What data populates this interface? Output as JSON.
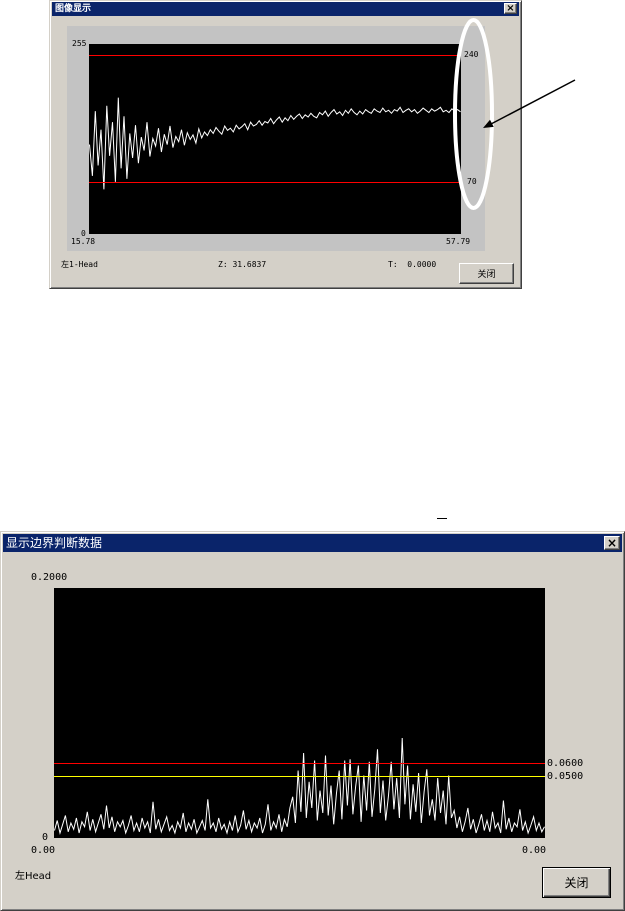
{
  "colors": {
    "title_bar": "#0a246a",
    "dialog_face": "#d4d0c8",
    "plot_panel": "#c3c3c3",
    "annotation_ellipse": "#ffffff",
    "annotation_arrow": "#000000"
  },
  "icons": {
    "close": "close-icon",
    "close_glyph": "×"
  },
  "top_window": {
    "title": "图像显示",
    "status": {
      "channel": "左1-Head",
      "z": "Z: 31.6837",
      "t": "T:  0.0000"
    },
    "close_button_label": "关闭"
  },
  "bottom_window": {
    "title": "显示边界判断数据",
    "channel_label": "左Head",
    "close_button_label": "关闭"
  },
  "chart_data": [
    {
      "type": "line",
      "xlim": [
        15.78,
        57.79
      ],
      "ylim": [
        0,
        255
      ],
      "x_tick_labels": [
        "15.78",
        "57.79"
      ],
      "y_tick_labels": [
        "0",
        "255"
      ],
      "grid": false,
      "plot_background": "#000000",
      "thresholds": [
        {
          "value": 240,
          "label": "240",
          "color": "#ff0000"
        },
        {
          "value": 70,
          "label": "70",
          "color": "#ff0000"
        }
      ],
      "series": [
        {
          "color": "#ffffff",
          "values": [
            120,
            78,
            165,
            92,
            140,
            60,
            172,
            105,
            150,
            70,
            183,
            88,
            158,
            74,
            135,
            102,
            146,
            95,
            130,
            112,
            150,
            104,
            128,
            118,
            142,
            110,
            134,
            120,
            145,
            116,
            131,
            124,
            140,
            119,
            136,
            127,
            133,
            122,
            141,
            129,
            137,
            132,
            140,
            135,
            143,
            138,
            134,
            145,
            139,
            142,
            137,
            146,
            141,
            144,
            148,
            140,
            150,
            145,
            147,
            152,
            146,
            151,
            149,
            155,
            148,
            153,
            157,
            150,
            156,
            152,
            159,
            154,
            158,
            161,
            155,
            160,
            157,
            162,
            158,
            156,
            163,
            160,
            165,
            158,
            163,
            167,
            161,
            164,
            159,
            166,
            162,
            168,
            163,
            160,
            165,
            161,
            167,
            164,
            162,
            168,
            165,
            163,
            169,
            164,
            166,
            162,
            167,
            165,
            170,
            163,
            166,
            168,
            164,
            167,
            162,
            165,
            169,
            166,
            163,
            168,
            165,
            167,
            170,
            164,
            166,
            163,
            168,
            165,
            167,
            164
          ]
        }
      ]
    },
    {
      "type": "line",
      "ylim": [
        0,
        0.2
      ],
      "x_tick_labels": [
        "0.00",
        "0.00"
      ],
      "y_tick_labels": [
        "0",
        "0.2000"
      ],
      "grid": false,
      "plot_background": "#000000",
      "thresholds": [
        {
          "value": 0.06,
          "label": "0.0600",
          "color": "#ff0000"
        },
        {
          "value": 0.05,
          "label": "0.0500",
          "color": "#ffff00"
        }
      ],
      "series": [
        {
          "color": "#ffffff",
          "values": [
            0.006,
            0.014,
            0.004,
            0.011,
            0.018,
            0.005,
            0.012,
            0.007,
            0.016,
            0.004,
            0.013,
            0.009,
            0.021,
            0.006,
            0.015,
            0.005,
            0.012,
            0.019,
            0.007,
            0.026,
            0.008,
            0.017,
            0.005,
            0.013,
            0.009,
            0.014,
            0.004,
            0.01,
            0.018,
            0.006,
            0.012,
            0.005,
            0.016,
            0.008,
            0.013,
            0.004,
            0.029,
            0.007,
            0.015,
            0.005,
            0.011,
            0.017,
            0.006,
            0.01,
            0.004,
            0.013,
            0.008,
            0.02,
            0.005,
            0.012,
            0.007,
            0.015,
            0.004,
            0.009,
            0.014,
            0.006,
            0.031,
            0.008,
            0.012,
            0.005,
            0.016,
            0.007,
            0.011,
            0.004,
            0.013,
            0.006,
            0.018,
            0.005,
            0.01,
            0.022,
            0.007,
            0.014,
            0.005,
            0.012,
            0.008,
            0.016,
            0.004,
            0.011,
            0.027,
            0.006,
            0.013,
            0.008,
            0.019,
            0.005,
            0.015,
            0.009,
            0.024,
            0.033,
            0.012,
            0.054,
            0.021,
            0.068,
            0.016,
            0.045,
            0.024,
            0.062,
            0.014,
            0.038,
            0.02,
            0.066,
            0.018,
            0.042,
            0.011,
            0.036,
            0.054,
            0.015,
            0.062,
            0.026,
            0.063,
            0.019,
            0.041,
            0.058,
            0.013,
            0.05,
            0.022,
            0.061,
            0.017,
            0.039,
            0.071,
            0.02,
            0.046,
            0.014,
            0.034,
            0.061,
            0.023,
            0.048,
            0.016,
            0.08,
            0.027,
            0.058,
            0.015,
            0.043,
            0.021,
            0.052,
            0.012,
            0.037,
            0.055,
            0.018,
            0.031,
            0.014,
            0.048,
            0.02,
            0.038,
            0.011,
            0.05,
            0.016,
            0.022,
            0.008,
            0.017,
            0.005,
            0.013,
            0.024,
            0.007,
            0.015,
            0.004,
            0.011,
            0.019,
            0.006,
            0.014,
            0.005,
            0.021,
            0.008,
            0.012,
            0.004,
            0.03,
            0.007,
            0.016,
            0.005,
            0.012,
            0.009,
            0.023,
            0.006,
            0.013,
            0.004,
            0.01,
            0.017,
            0.006,
            0.012,
            0.005,
            0.009
          ]
        }
      ]
    }
  ]
}
